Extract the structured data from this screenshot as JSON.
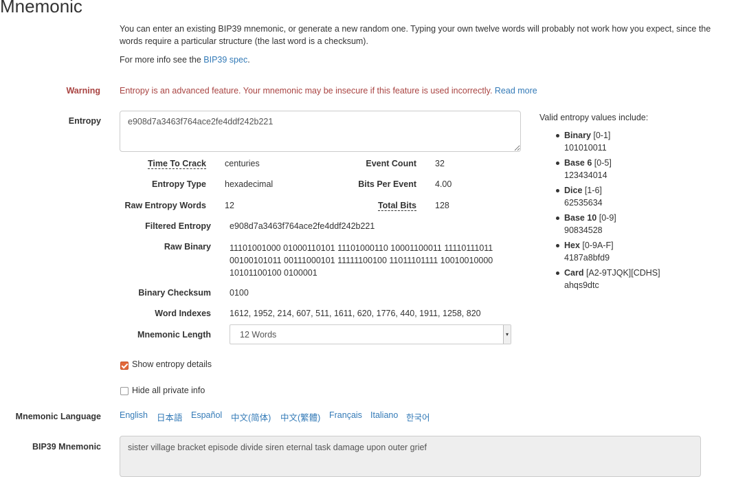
{
  "section_title": "Mnemonic",
  "intro": {
    "line1": "You can enter an existing BIP39 mnemonic, or generate a new random one. Typing your own twelve words will probably not work how you expect, since the",
    "line2": "words require a particular structure (the last word is a checksum).",
    "more_info_prefix": "For more info see the ",
    "more_info_link": "BIP39 spec",
    "more_info_suffix": "."
  },
  "warning": {
    "label": "Warning",
    "text": "Entropy is an advanced feature. Your mnemonic may be insecure if this feature is used incorrectly.",
    "link": "Read more"
  },
  "entropy": {
    "label": "Entropy",
    "value": "e908d7a3463f764ace2fe4ddf242b221"
  },
  "details": {
    "time_to_crack_label": "Time To Crack",
    "time_to_crack_value": "centuries",
    "event_count_label": "Event Count",
    "event_count_value": "32",
    "entropy_type_label": "Entropy Type",
    "entropy_type_value": "hexadecimal",
    "bits_per_event_label": "Bits Per Event",
    "bits_per_event_value": "4.00",
    "raw_entropy_words_label": "Raw Entropy Words",
    "raw_entropy_words_value": "12",
    "total_bits_label": "Total Bits",
    "total_bits_value": "128",
    "filtered_entropy_label": "Filtered Entropy",
    "filtered_entropy_value": "e908d7a3463f764ace2fe4ddf242b221",
    "raw_binary_label": "Raw Binary",
    "raw_binary_line1": "11101001000 01000110101 11101000110 10001100011 11110111011",
    "raw_binary_line2": "00100101011 00111000101 11111100100 11011101111 10010010000",
    "raw_binary_line3": "10101100100 0100001",
    "binary_checksum_label": "Binary Checksum",
    "binary_checksum_value": "0100",
    "word_indexes_label": "Word Indexes",
    "word_indexes_value": "1612, 1952, 214, 607, 511, 1611, 620, 1776, 440, 1911, 1258, 820",
    "mnemonic_length_label": "Mnemonic Length",
    "mnemonic_length_value": "12 Words"
  },
  "valid_entropy": {
    "title": "Valid entropy values include:",
    "items": [
      {
        "name": "Binary",
        "range": " [0-1]",
        "example": "101010011"
      },
      {
        "name": "Base 6",
        "range": " [0-5]",
        "example": "123434014"
      },
      {
        "name": "Dice",
        "range": " [1-6]",
        "example": "62535634"
      },
      {
        "name": "Base 10",
        "range": " [0-9]",
        "example": "90834528"
      },
      {
        "name": "Hex",
        "range": " [0-9A-F]",
        "example": "4187a8bfd9"
      },
      {
        "name": "Card",
        "range": " [A2-9TJQK][CDHS]",
        "example": "ahqs9dtc"
      }
    ]
  },
  "options": {
    "show_entropy_details": "Show entropy details",
    "hide_private_info": "Hide all private info"
  },
  "language": {
    "label": "Mnemonic Language",
    "items": [
      "English",
      "日本語",
      "Español",
      "中文(简体)",
      "中文(繁體)",
      "Français",
      "Italiano",
      "한국어"
    ]
  },
  "bip39": {
    "label": "BIP39 Mnemonic",
    "value": "sister village bracket episode divide siren eternal task damage upon outer grief"
  }
}
